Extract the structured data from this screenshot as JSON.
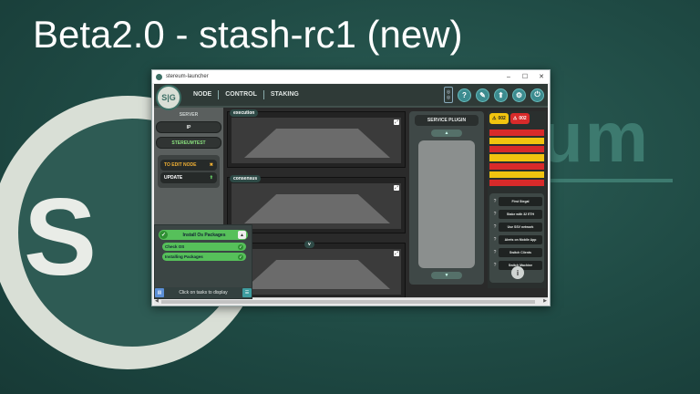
{
  "slide": {
    "title": "Beta2.0 - stash-rc1 (new)"
  },
  "backdrop": {
    "letter": "S",
    "wordmark": "um"
  },
  "window": {
    "title": "stereum-launcher",
    "controls": {
      "minimize": "–",
      "maximize": "☐",
      "close": "✕"
    }
  },
  "topbar": {
    "logo_text": "S|G",
    "nav": [
      "NODE",
      "CONTROL",
      "STAKING"
    ],
    "icons": [
      "help-icon",
      "wrench-icon",
      "update-arrow-icon",
      "gear-icon",
      "logout-icon"
    ]
  },
  "sidebar": {
    "server_label": "SERVER",
    "ip_label": "IP",
    "server_name": "STEREUMTEST",
    "edit_node_label": "TO EDIT NODE",
    "update_label": "UPDATE"
  },
  "services": [
    {
      "label": "execution"
    },
    {
      "label": "consensus"
    },
    {
      "label": "v"
    }
  ],
  "plugin": {
    "title": "SERVICE PLUGIN"
  },
  "alerts": {
    "warning_count": "002",
    "critical_count": "002",
    "stripe_colors": [
      "#d82a2a",
      "#f1c40f",
      "#d82a2a",
      "#f1c40f",
      "#d82a2a",
      "#f1c40f",
      "#d82a2a"
    ]
  },
  "tasks_panel": {
    "items": [
      "First Stegal",
      "Stake with 32 ETH",
      "Use SSV network",
      "Alerts on Mobile App",
      "Switch Clients",
      "Switch Machine"
    ],
    "info": "i"
  },
  "popup": {
    "heading": "Install Os Packages",
    "subtasks": [
      "Check OS",
      "Installing Packages"
    ],
    "footer": "Click on tasks to display"
  }
}
